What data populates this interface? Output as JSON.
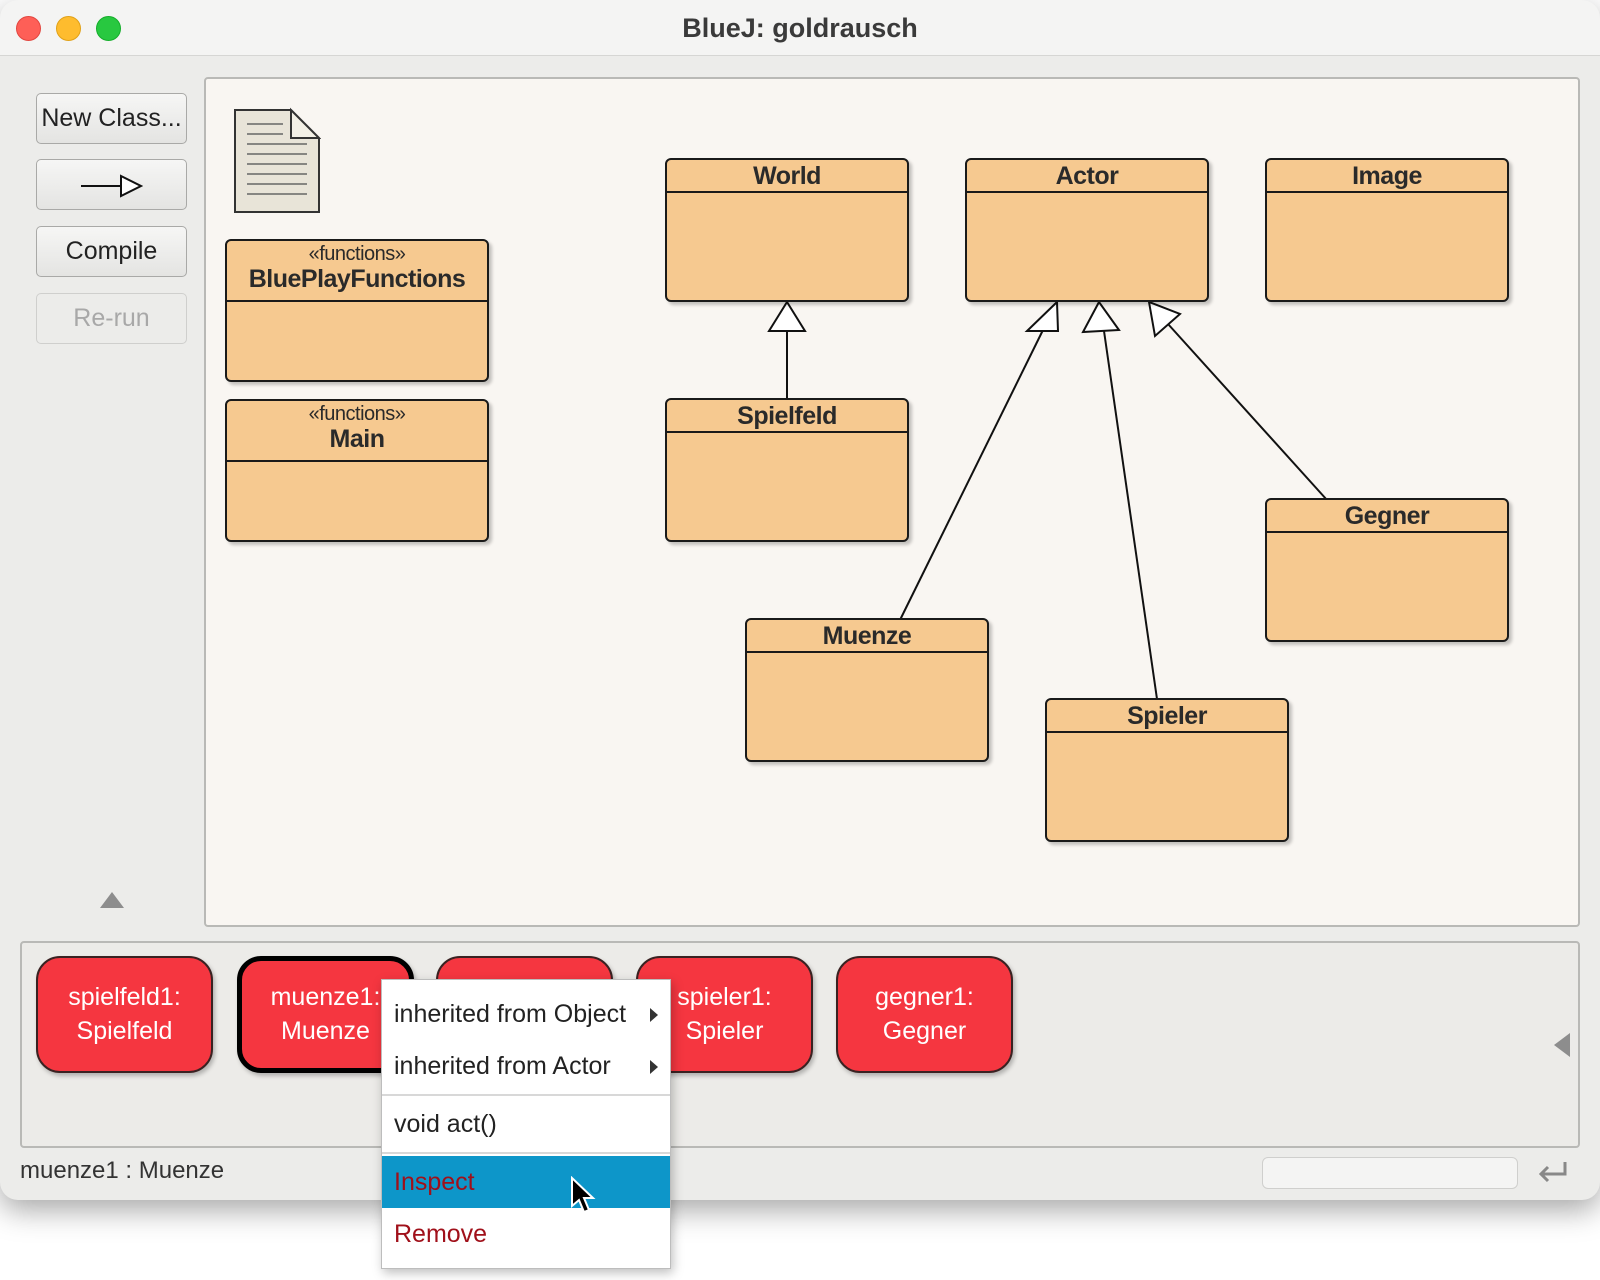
{
  "window": {
    "title": "BlueJ:  goldrausch"
  },
  "sidebar": {
    "new_class": "New Class...",
    "arrow_tool": "inheritance-arrow",
    "compile": "Compile",
    "rerun": "Re-run"
  },
  "diagram": {
    "classes": [
      {
        "stereotype": "«functions»",
        "name": "BluePlayFunctions"
      },
      {
        "stereotype": "«functions»",
        "name": "Main"
      },
      {
        "name": "World"
      },
      {
        "name": "Actor"
      },
      {
        "name": "Image"
      },
      {
        "name": "Spielfeld"
      },
      {
        "name": "Gegner"
      },
      {
        "name": "Muenze"
      },
      {
        "name": "Spieler"
      }
    ],
    "inheritance": [
      {
        "from": "Spielfeld",
        "to": "World"
      },
      {
        "from": "Muenze",
        "to": "Actor"
      },
      {
        "from": "Spieler",
        "to": "Actor"
      },
      {
        "from": "Gegner",
        "to": "Actor"
      }
    ]
  },
  "object_bench": {
    "objects": [
      {
        "line1": "spielfeld1:",
        "line2": "Spielfeld"
      },
      {
        "line1": "muenze1:",
        "line2": "Muenze",
        "selected": true
      },
      {
        "line1": "",
        "line2": ""
      },
      {
        "line1": "spieler1:",
        "line2": "Spieler"
      },
      {
        "line1": "gegner1:",
        "line2": "Gegner"
      }
    ]
  },
  "context_menu": {
    "items": [
      "inherited from Object",
      "inherited from Actor",
      "void act()",
      "Inspect",
      "Remove"
    ],
    "highlighted": "Inspect"
  },
  "status_bar": {
    "text": "muenze1 : Muenze"
  },
  "colors": {
    "class_fill": "#f6c990",
    "object_fill": "#f53640",
    "menu_highlight": "#0d96c9",
    "danger_text": "#a0101a"
  }
}
